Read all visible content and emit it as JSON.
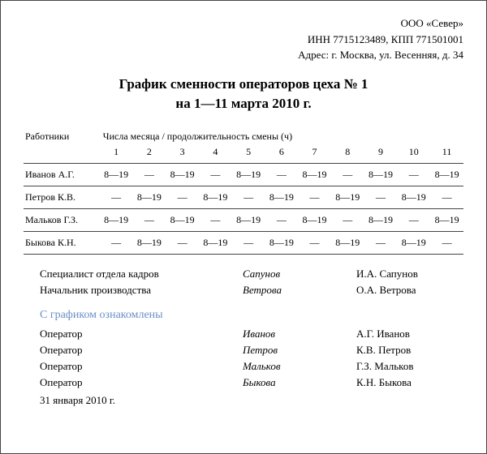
{
  "header": {
    "company": "ООО «Север»",
    "ids": "ИНН 7715123489, КПП 771501001",
    "address": "Адрес: г. Москва, ул. Весенняя, д. 34"
  },
  "title": {
    "line1": "График сменности операторов цеха № 1",
    "line2": "на 1—11 марта 2010 г."
  },
  "table": {
    "col_emp": "Работники",
    "col_span": "Числа месяца / продолжительность смены (ч)",
    "days": [
      "1",
      "2",
      "3",
      "4",
      "5",
      "6",
      "7",
      "8",
      "9",
      "10",
      "11"
    ],
    "rows": [
      {
        "name": "Иванов А.Г.",
        "cells": [
          "8—19",
          "—",
          "8—19",
          "—",
          "8—19",
          "—",
          "8—19",
          "—",
          "8—19",
          "—",
          "8—19"
        ]
      },
      {
        "name": "Петров К.В.",
        "cells": [
          "—",
          "8—19",
          "—",
          "8—19",
          "—",
          "8—19",
          "—",
          "8—19",
          "—",
          "8—19",
          "—"
        ]
      },
      {
        "name": "Мальков Г.З.",
        "cells": [
          "8—19",
          "—",
          "8—19",
          "—",
          "8—19",
          "—",
          "8—19",
          "—",
          "8—19",
          "—",
          "8—19"
        ]
      },
      {
        "name": "Быкова К.Н.",
        "cells": [
          "—",
          "8—19",
          "—",
          "8—19",
          "—",
          "8—19",
          "—",
          "8—19",
          "—",
          "8—19",
          "—"
        ]
      }
    ]
  },
  "approvers": [
    {
      "role": "Специалист отдела кадров",
      "sign": "Сапунов",
      "name": "И.А. Сапунов"
    },
    {
      "role": "Начальник производства",
      "sign": "Ветрова",
      "name": "О.А. Ветрова"
    }
  ],
  "ack": {
    "heading": "С графиком ознакомлены",
    "list": [
      {
        "role": "Оператор",
        "sign": "Иванов",
        "name": "А.Г. Иванов"
      },
      {
        "role": "Оператор",
        "sign": "Петров",
        "name": "К.В. Петров"
      },
      {
        "role": "Оператор",
        "sign": "Мальков",
        "name": "Г.З. Мальков"
      },
      {
        "role": "Оператор",
        "sign": "Быкова",
        "name": "К.Н. Быкова"
      }
    ]
  },
  "date": "31 января 2010 г."
}
